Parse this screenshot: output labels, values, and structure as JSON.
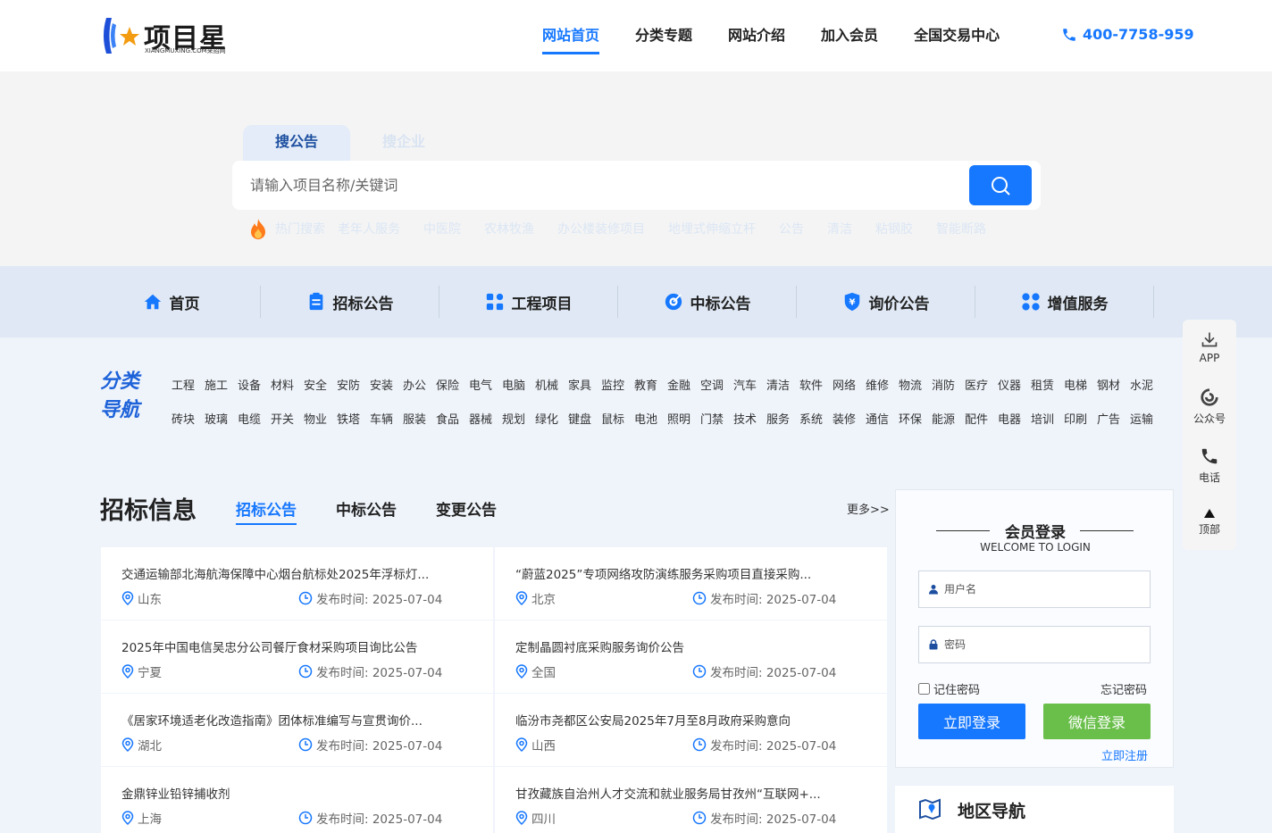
{
  "brand": {
    "name": "项目星",
    "sub": "XIANGMUXING.COM采招网"
  },
  "nav": [
    "网站首页",
    "分类专题",
    "网站介绍",
    "加入会员",
    "全国交易中心"
  ],
  "phone": "400-7758-959",
  "search": {
    "tabs": [
      "搜公告",
      "搜企业"
    ],
    "placeholder": "请输入项目名称/关键词",
    "hot_label": "热门搜索",
    "hot": [
      "老年人服务",
      "中医院",
      "农林牧渔",
      "办公楼装修项目",
      "地埋式伸缩立杆",
      "公告",
      "清洁",
      "粘钢胶",
      "智能断路"
    ]
  },
  "categories": [
    "首页",
    "招标公告",
    "工程项目",
    "中标公告",
    "询价公告",
    "增值服务"
  ],
  "fenlei": {
    "line1": "分类",
    "line2": "导航",
    "row1": [
      "工程",
      "施工",
      "设备",
      "材料",
      "安全",
      "安防",
      "安装",
      "办公",
      "保险",
      "电气",
      "电脑",
      "机械",
      "家具",
      "监控",
      "教育",
      "金融",
      "空调",
      "汽车",
      "清洁",
      "软件",
      "网络",
      "维修",
      "物流",
      "消防",
      "医疗",
      "仪器",
      "租赁",
      "电梯",
      "钢材",
      "水泥"
    ],
    "row2": [
      "砖块",
      "玻璃",
      "电缆",
      "开关",
      "物业",
      "铁塔",
      "车辆",
      "服装",
      "食品",
      "器械",
      "规划",
      "绿化",
      "键盘",
      "鼠标",
      "电池",
      "照明",
      "门禁",
      "技术",
      "服务",
      "系统",
      "装修",
      "通信",
      "环保",
      "能源",
      "配件",
      "电器",
      "培训",
      "印刷",
      "广告",
      "运输"
    ]
  },
  "bid": {
    "title": "招标信息",
    "tabs": [
      "招标公告",
      "中标公告",
      "变更公告"
    ],
    "more": "更多>>",
    "date_prefix": "发布时间: ",
    "items": [
      {
        "title": "交通运输部北海航海保障中心烟台航标处2025年浮标灯...",
        "loc": "山东",
        "date": "发布时间: 2025-07-04"
      },
      {
        "title": "“蔚蓝2025”专项网络攻防演练服务采购项目直接采购...",
        "loc": "北京",
        "date": "发布时间: 2025-07-04"
      },
      {
        "title": "2025年中国电信吴忠分公司餐厅食材采购项目询比公告",
        "loc": "宁夏",
        "date": "发布时间: 2025-07-04"
      },
      {
        "title": "定制晶圆衬底采购服务询价公告",
        "loc": "全国",
        "date": "发布时间: 2025-07-04"
      },
      {
        "title": "《居家环境适老化改造指南》团体标准编写与宣贯询价...",
        "loc": "湖北",
        "date": "发布时间: 2025-07-04"
      },
      {
        "title": "临汾市尧都区公安局2025年7月至8月政府采购意向",
        "loc": "山西",
        "date": "发布时间: 2025-07-04"
      },
      {
        "title": "金鼎锌业铅锌捕收剂",
        "loc": "上海",
        "date": "发布时间: 2025-07-04"
      },
      {
        "title": "甘孜藏族自治州人才交流和就业服务局甘孜州“互联网+...",
        "loc": "四川",
        "date": "发布时间: 2025-07-04"
      }
    ]
  },
  "login": {
    "title": "会员登录",
    "subtitle": "WELCOME TO LOGIN",
    "user_ph": "用户名",
    "pwd_ph": "密码",
    "remember": "记住密码",
    "forgot": "忘记密码",
    "login_btn": "立即登录",
    "wechat_btn": "微信登录",
    "register": "立即注册"
  },
  "region": {
    "title": "地区导航"
  },
  "side": [
    "APP",
    "公众号",
    "电话",
    "顶部"
  ],
  "colors": {
    "accent": "#1677ff",
    "wechat": "#6abf4b",
    "hot": "#ff7a1a"
  }
}
